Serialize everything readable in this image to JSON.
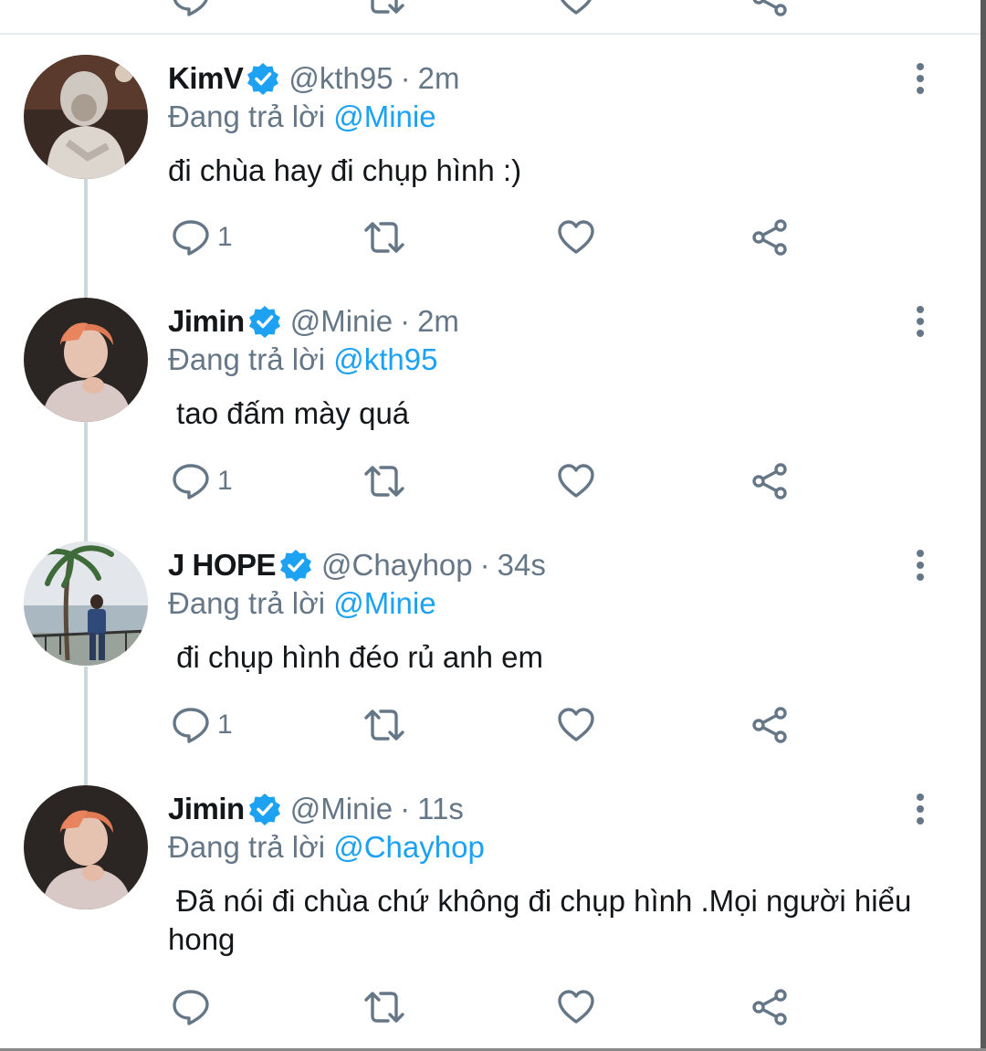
{
  "reply_prefix": "Đang trả lời",
  "colors": {
    "accent": "#1da1f2",
    "muted": "#657786",
    "verified": "#1da1f2",
    "text": "#14171a",
    "thread": "#ccd6dd"
  },
  "icons": {
    "reply": "reply-icon",
    "retweet": "retweet-icon",
    "like": "like-icon",
    "share": "share-icon",
    "more": "more-vertical-icon",
    "verified": "verified-badge-icon"
  },
  "tweets": [
    {
      "name": "KimV",
      "handle": "@kth95",
      "dot": "·",
      "time": "2m",
      "reply_to": "@Minie",
      "text": "đi chùa hay đi chụp hình :)",
      "reply_count": "1"
    },
    {
      "name": "Jimin",
      "handle": "@Minie",
      "dot": "·",
      "time": "2m",
      "reply_to": "@kth95",
      "text": " tao đấm mày quá",
      "reply_count": "1"
    },
    {
      "name": "J HOPE",
      "handle": "@Chayhop",
      "dot": "·",
      "time": "34s",
      "reply_to": "@Minie",
      "text": " đi chụp hình đéo rủ anh em",
      "reply_count": "1"
    },
    {
      "name": "Jimin",
      "handle": "@Minie",
      "dot": "·",
      "time": "11s",
      "reply_to": "@Chayhop",
      "text": " Đã nói đi chùa chứ không đi chụp hình .Mọi người hiểu hong",
      "reply_count": ""
    }
  ]
}
